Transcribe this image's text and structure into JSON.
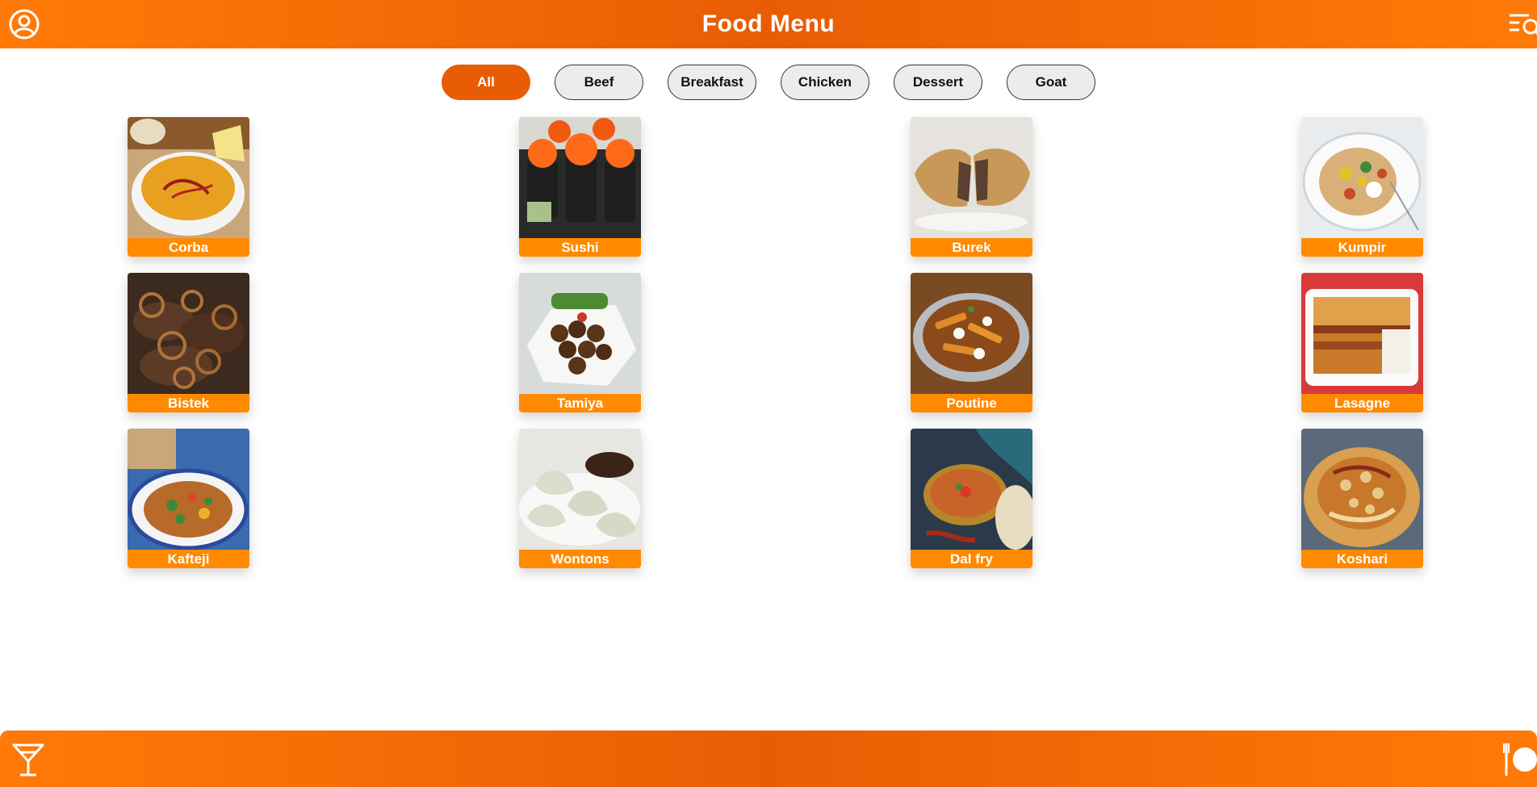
{
  "header": {
    "title": "Food Menu",
    "profile_icon": "user-circle-icon",
    "search_icon": "menu-search-icon"
  },
  "filters": [
    "All",
    "Beef",
    "Breakfast",
    "Chicken",
    "Dessert",
    "Goat"
  ],
  "active_filter": "All",
  "items": [
    {
      "name": "Corba",
      "image": "soup-bowl"
    },
    {
      "name": "Sushi",
      "image": "sushi-rolls"
    },
    {
      "name": "Burek",
      "image": "pastry"
    },
    {
      "name": "Kumpir",
      "image": "stuffed-potato"
    },
    {
      "name": "Bistek",
      "image": "steak-onions"
    },
    {
      "name": "Tamiya",
      "image": "falafel"
    },
    {
      "name": "Poutine",
      "image": "fries-gravy"
    },
    {
      "name": "Lasagne",
      "image": "lasagne-dish"
    },
    {
      "name": "Kafteji",
      "image": "vegetable-plate"
    },
    {
      "name": "Wontons",
      "image": "dumplings"
    },
    {
      "name": "Dal fry",
      "image": "curry-bowl"
    },
    {
      "name": "Koshari",
      "image": "rice-lentils"
    }
  ],
  "footer": {
    "drinks_icon": "cocktail-glass-icon",
    "meals_icon": "fork-plate-icon"
  },
  "colors": {
    "accent": "#e85d04",
    "accent_light": "#ff7a08",
    "label_bg": "#ff8a00",
    "chip_bg": "#ececec"
  }
}
